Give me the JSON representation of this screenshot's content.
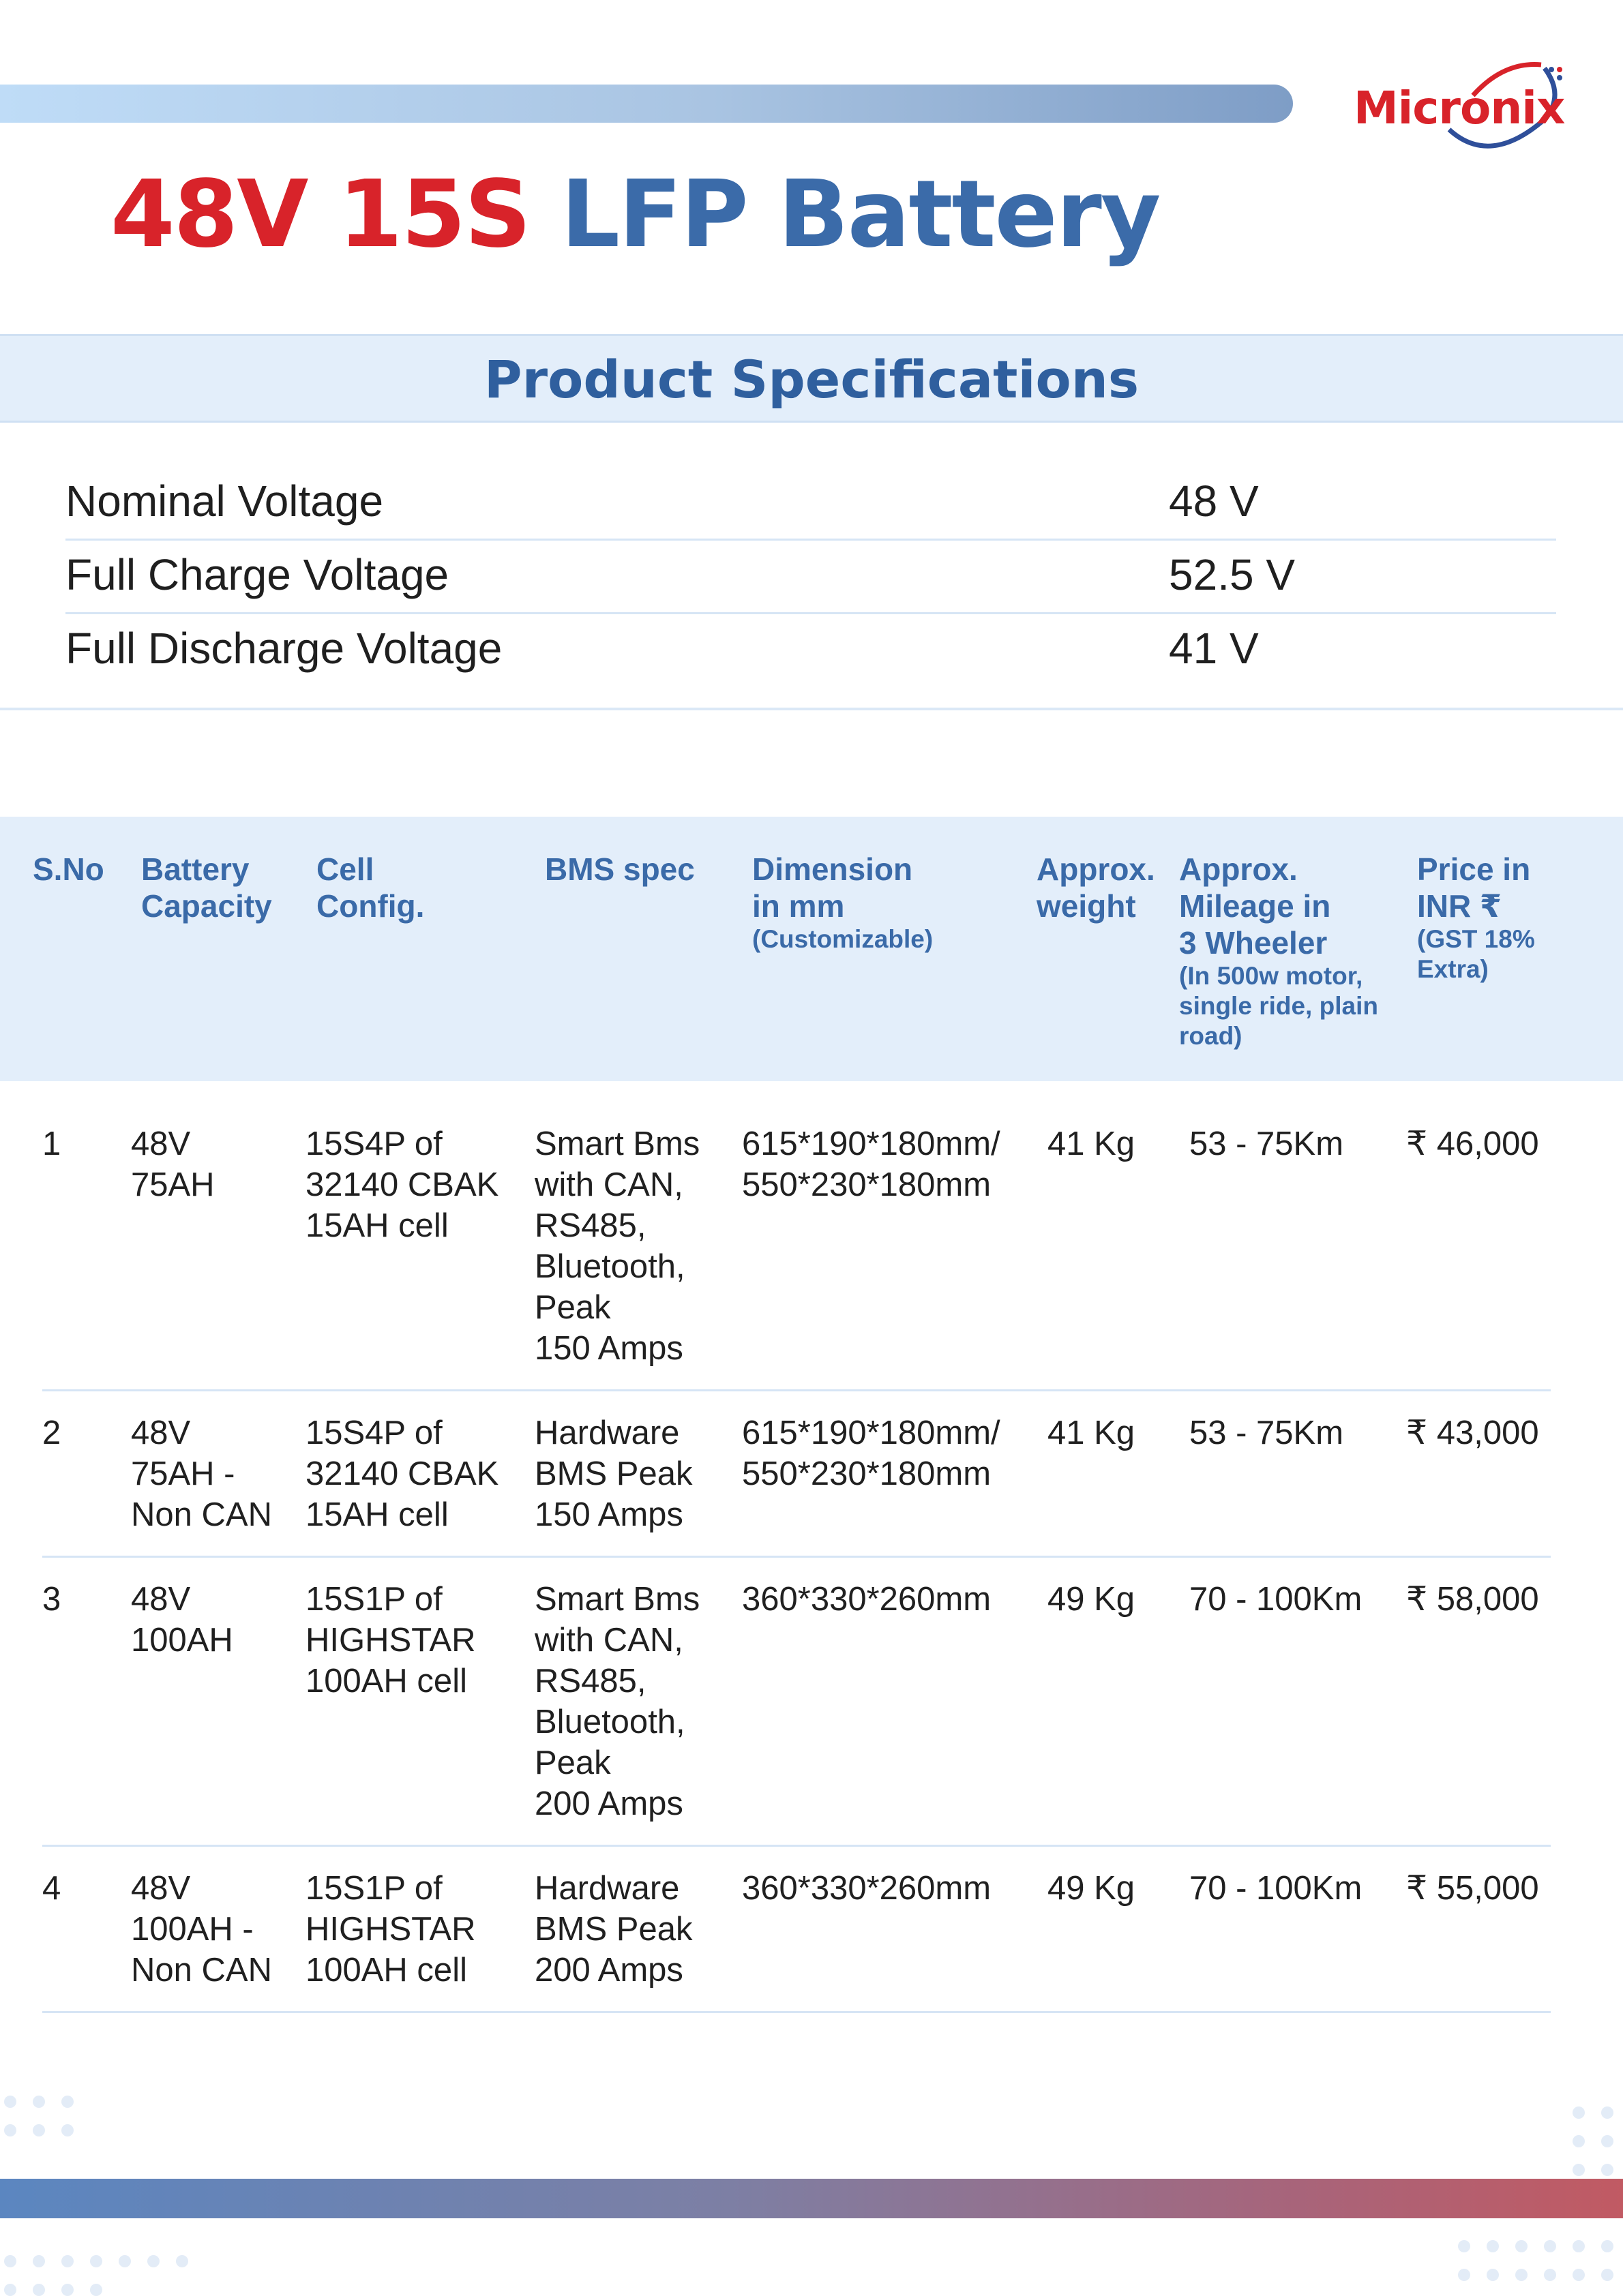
{
  "brand": {
    "logo_text": "Micronix",
    "red": "#d8232a",
    "blue": "#3b6ba9"
  },
  "title": {
    "part1": "48V 15S",
    "part2": "LFP Battery"
  },
  "specs": {
    "heading": "Product Specifications",
    "rows": [
      {
        "label": "Nominal Voltage",
        "value": "48 V"
      },
      {
        "label": "Full Charge Voltage",
        "value": "52.5 V"
      },
      {
        "label": "Full Discharge Voltage",
        "value": "41 V"
      }
    ]
  },
  "table": {
    "headers": {
      "sno": "S.No",
      "capacity": "Battery\nCapacity",
      "cell": "Cell\nConfig.",
      "bms": "BMS spec",
      "dimension": "Dimension\nin mm",
      "dimension_note": "(Customizable)",
      "weight": "Approx.\nweight",
      "mileage": "Approx.\nMileage in\n3 Wheeler",
      "mileage_note": "(In 500w motor,\nsingle ride, plain\nroad)",
      "price": "Price in\nINR ₹",
      "price_note": "(GST 18%\nExtra)"
    },
    "rows": [
      {
        "sno": "1",
        "capacity": "48V\n75AH",
        "cell": "15S4P of\n32140 CBAK\n15AH cell",
        "bms": "Smart Bms\nwith CAN,\nRS485,\nBluetooth,\nPeak\n150 Amps",
        "dimension": "615*190*180mm/\n550*230*180mm",
        "weight": "41 Kg",
        "mileage": "53 - 75Km",
        "price": "₹ 46,000"
      },
      {
        "sno": "2",
        "capacity": "48V\n75AH -\nNon CAN",
        "cell": "15S4P of\n32140 CBAK\n15AH cell",
        "bms": "Hardware\nBMS Peak\n150 Amps",
        "dimension": "615*190*180mm/\n550*230*180mm",
        "weight": "41 Kg",
        "mileage": "53 - 75Km",
        "price": "₹ 43,000"
      },
      {
        "sno": "3",
        "capacity": "48V\n100AH",
        "cell": "15S1P of\nHIGHSTAR\n100AH cell",
        "bms": "Smart Bms\nwith CAN,\nRS485,\nBluetooth,\nPeak\n200 Amps",
        "dimension": "360*330*260mm",
        "weight": "49 Kg",
        "mileage": "70 - 100Km",
        "price": "₹ 58,000"
      },
      {
        "sno": "4",
        "capacity": "48V\n100AH -\nNon CAN",
        "cell": "15S1P of\nHIGHSTAR\n100AH cell",
        "bms": "Hardware\nBMS Peak\n200 Amps",
        "dimension": "360*330*260mm",
        "weight": "49 Kg",
        "mileage": "70 - 100Km",
        "price": "₹ 55,000"
      }
    ]
  }
}
